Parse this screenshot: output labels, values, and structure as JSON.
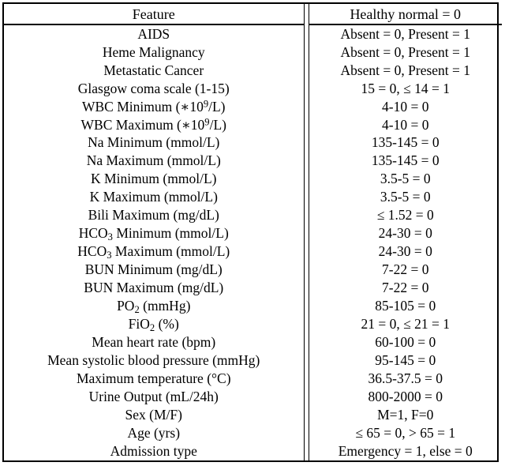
{
  "table": {
    "columns": [
      {
        "key": "feature",
        "label": "Feature"
      },
      {
        "key": "value",
        "label": "Healthy normal = 0"
      }
    ],
    "rows": [
      {
        "feature": "AIDS",
        "value": "Absent = 0, Present = 1"
      },
      {
        "feature": "Heme Malignancy",
        "value": "Absent = 0, Present = 1"
      },
      {
        "feature": "Metastatic Cancer",
        "value": "Absent = 0, Present = 1"
      },
      {
        "feature": "Glasgow coma scale (1-15)",
        "value": "15 = 0, ≤ 14 = 1"
      },
      {
        "feature": "WBC Minimum (∗109/L)",
        "feature_html": "WBC Minimum (∗10<sup>9</sup>/L)",
        "value": "4-10 = 0"
      },
      {
        "feature": "WBC Maximum (∗109/L)",
        "feature_html": "WBC Maximum (∗10<sup>9</sup>/L)",
        "value": "4-10 = 0"
      },
      {
        "feature": "Na Minimum (mmol/L)",
        "value": "135-145 = 0"
      },
      {
        "feature": "Na Maximum (mmol/L)",
        "value": "135-145 = 0"
      },
      {
        "feature": "K Minimum (mmol/L)",
        "value": "3.5-5 = 0"
      },
      {
        "feature": "K Maximum (mmol/L)",
        "value": "3.5-5 = 0"
      },
      {
        "feature": "Bili Maximum (mg/dL)",
        "value": "≤ 1.52 = 0"
      },
      {
        "feature": "HCO3 Minimum (mmol/L)",
        "feature_html": "HCO<sub>3</sub> Minimum (mmol/L)",
        "value": "24-30 = 0"
      },
      {
        "feature": "HCO3 Maximum (mmol/L)",
        "feature_html": "HCO<sub>3</sub> Maximum (mmol/L)",
        "value": "24-30 = 0"
      },
      {
        "feature": "BUN Minimum (mg/dL)",
        "value": "7-22 = 0"
      },
      {
        "feature": "BUN Maximum (mg/dL)",
        "value": "7-22 = 0"
      },
      {
        "feature": "PO2 (mmHg)",
        "feature_html": "PO<sub>2</sub> (mmHg)",
        "value": "85-105 = 0"
      },
      {
        "feature": "FiO2 (%)",
        "feature_html": "FiO<sub>2</sub> (%)",
        "value": "21 = 0, ≤ 21 = 1"
      },
      {
        "feature": "Mean heart rate (bpm)",
        "value": "60-100 = 0"
      },
      {
        "feature": "Mean systolic blood pressure (mmHg)",
        "value": "95-145 = 0"
      },
      {
        "feature": "Maximum temperature (°C)",
        "value": "36.5-37.5 = 0"
      },
      {
        "feature": "Urine Output (mL/24h)",
        "value": "800-2000 = 0"
      },
      {
        "feature": "Sex (M/F)",
        "value": "M=1, F=0"
      },
      {
        "feature": "Age (yrs)",
        "value": "≤ 65 = 0, > 65 = 1"
      },
      {
        "feature": "Admission type",
        "value": "Emergency = 1, else = 0"
      }
    ]
  },
  "style": {
    "text_color": "#000000",
    "background_color": "#ffffff",
    "rule_color": "#000000"
  }
}
